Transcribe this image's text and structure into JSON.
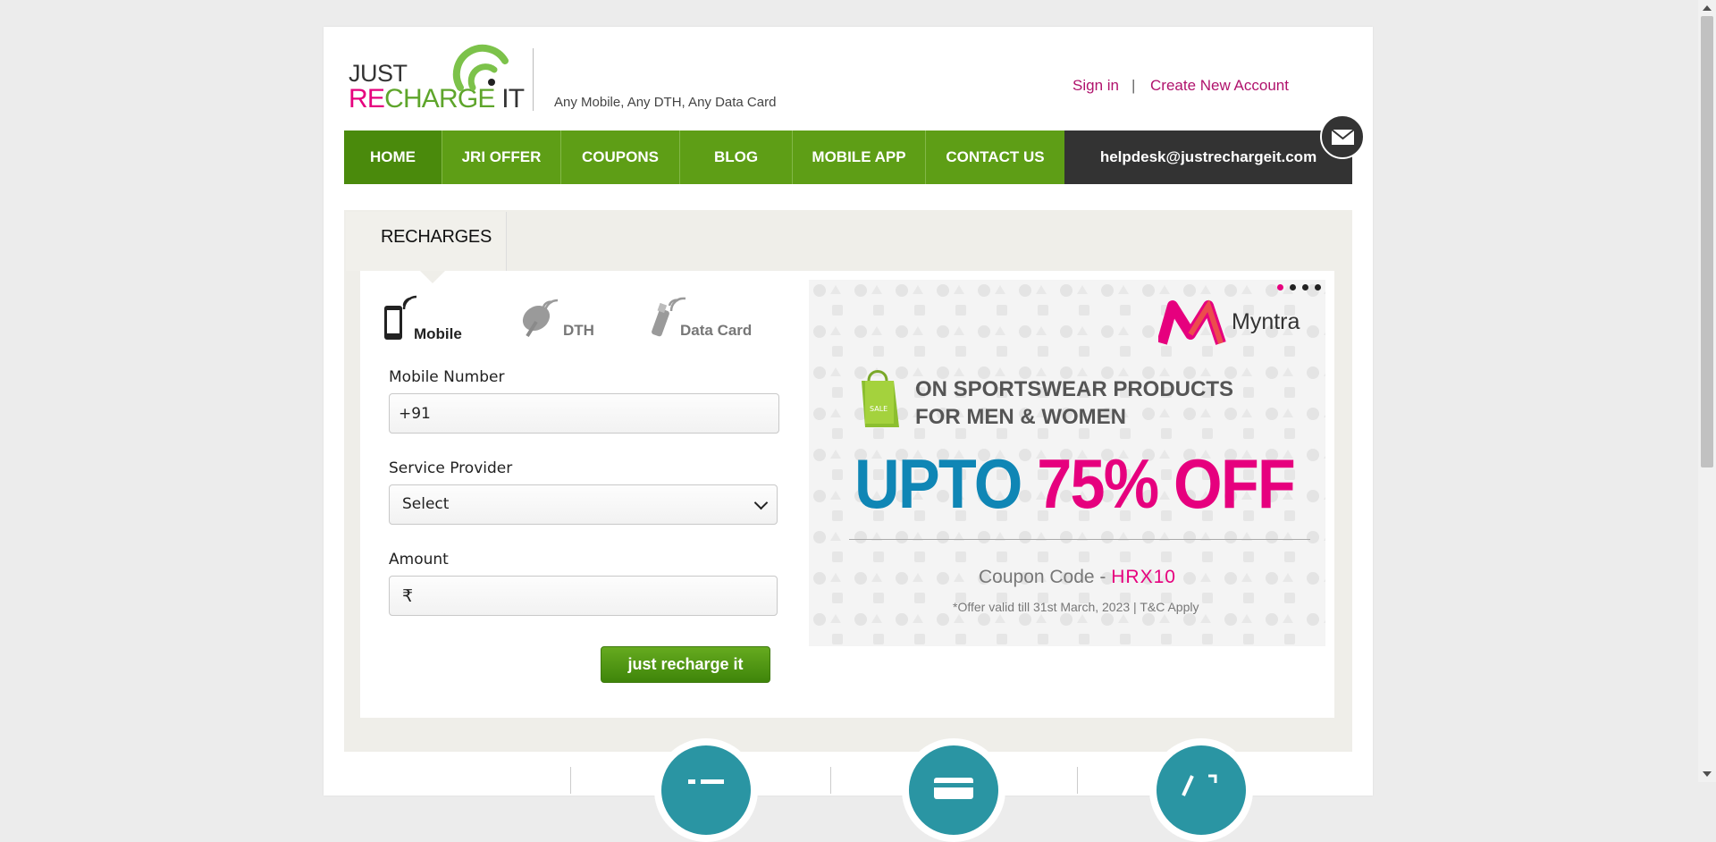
{
  "header": {
    "logo": {
      "just": "JUST",
      "re": "RE",
      "charge": "CHARGE",
      "it": "IT"
    },
    "tagline": "Any Mobile, Any DTH, Any Data Card",
    "sign_in": "Sign in",
    "separator": "|",
    "create_account": "Create New Account"
  },
  "nav": {
    "items": [
      {
        "label": "HOME",
        "active": true
      },
      {
        "label": "JRI OFFER"
      },
      {
        "label": "COUPONS"
      },
      {
        "label": "BLOG"
      },
      {
        "label": "MOBILE APP"
      },
      {
        "label": "CONTACT US"
      }
    ],
    "helpdesk_email": "helpdesk@justrechargeit.com"
  },
  "recharges": {
    "tab_label": "RECHARGES",
    "services": [
      {
        "label": "Mobile",
        "icon": "mobile-phone-icon",
        "selected": true
      },
      {
        "label": "DTH",
        "icon": "satellite-dish-icon"
      },
      {
        "label": "Data Card",
        "icon": "usb-data-card-icon"
      }
    ],
    "form": {
      "mobile_label": "Mobile Number",
      "mobile_value": "+91",
      "provider_label": "Service Provider",
      "provider_value": "Select",
      "amount_label": "Amount",
      "amount_value": "",
      "currency_symbol": "₹",
      "submit_label": "just recharge it"
    }
  },
  "banner": {
    "brand": "Myntra",
    "line1": "ON SPORTSWEAR PRODUCTS",
    "line2": "FOR MEN & WOMEN",
    "upto": "UPTO",
    "discount": "75% OFF",
    "coupon_prefix": "Coupon Code - ",
    "coupon_code": "HRX10",
    "offer_note": "*Offer valid till 31st March, 2023 | T&C Apply",
    "slide_count": 4,
    "active_slide": 1,
    "sale_tag": "SALE"
  },
  "colors": {
    "green": "#5e9e16",
    "pink": "#e6007e",
    "teal": "#2a95a3",
    "blue": "#0f86b5"
  }
}
